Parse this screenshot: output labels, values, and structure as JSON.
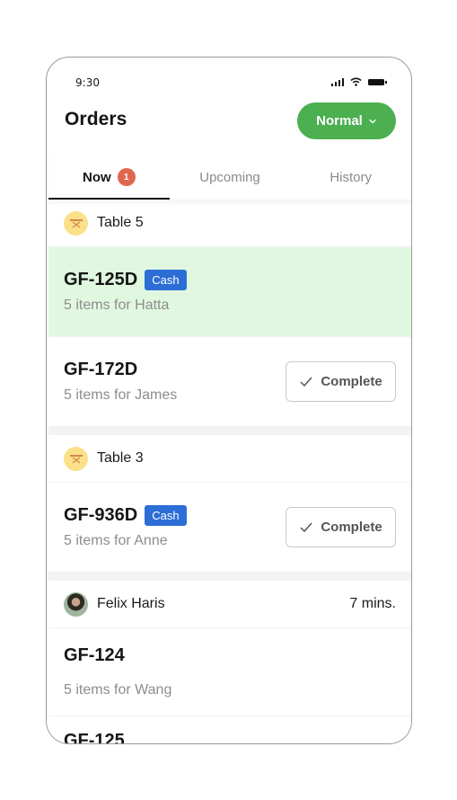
{
  "status_bar": {
    "time": "9:30",
    "icons": [
      "cellular-signal-icon",
      "wifi-icon",
      "battery-icon"
    ]
  },
  "header": {
    "title": "Orders",
    "mode_button": {
      "label": "Normal",
      "icon": "chevron-down-icon",
      "color": "#4caf50"
    }
  },
  "tabs": [
    {
      "label": "Now",
      "badge": "1",
      "active": true
    },
    {
      "label": "Upcoming",
      "active": false
    },
    {
      "label": "History",
      "active": false
    }
  ],
  "groups": [
    {
      "type": "table",
      "icon": "table-icon",
      "label": "Table 5",
      "orders": [
        {
          "id": "GF-125D",
          "tag": "Cash",
          "subtitle": "5 items for Hatta",
          "highlighted": true
        },
        {
          "id": "GF-172D",
          "subtitle": "5 items for James",
          "action": "Complete"
        }
      ]
    },
    {
      "type": "table",
      "icon": "table-icon",
      "label": "Table 3",
      "orders": [
        {
          "id": "GF-936D",
          "tag": "Cash",
          "subtitle": "5 items for Anne",
          "action": "Complete"
        }
      ]
    },
    {
      "type": "customer",
      "icon": "avatar",
      "label": "Felix Haris",
      "meta": "7 mins.",
      "orders": [
        {
          "id": "GF-124",
          "subtitle": "5 items for Wang"
        },
        {
          "id": "GF-125"
        }
      ]
    }
  ],
  "colors": {
    "accent_green": "#4caf50",
    "highlight_bg": "#e1f8e0",
    "cash_tag": "#2c6ed6",
    "badge_red": "#e06650",
    "table_icon_bg": "#fbe08a"
  }
}
